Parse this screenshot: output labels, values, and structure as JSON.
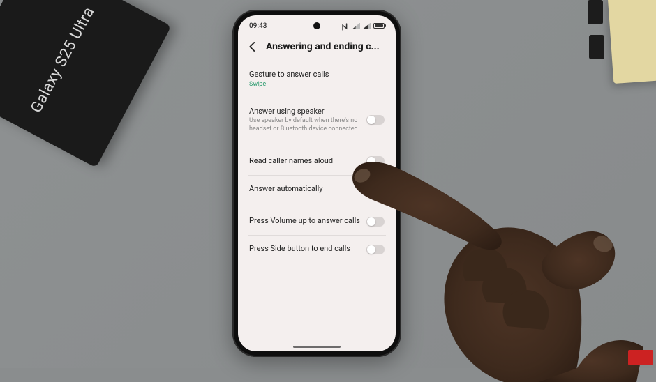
{
  "box_label": "Galaxy S25 Ultra",
  "status": {
    "time": "09:43"
  },
  "header": {
    "title": "Answering and ending c..."
  },
  "settings": {
    "gesture": {
      "title": "Gesture to answer calls",
      "value": "Swipe"
    },
    "speaker": {
      "title": "Answer using speaker",
      "sub": "Use speaker by default when there's no headset or Bluetooth device connected."
    },
    "read_names": {
      "title": "Read caller names aloud"
    },
    "auto_answer": {
      "title": "Answer automatically"
    },
    "volume_up": {
      "title": "Press Volume up to answer calls"
    },
    "side_button": {
      "title": "Press Side button to end calls"
    }
  }
}
